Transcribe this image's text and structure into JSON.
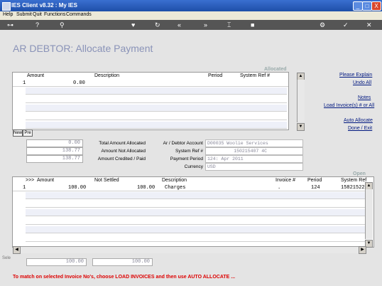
{
  "window": {
    "title": "IES Client v8.32 : My IES",
    "min": "_",
    "max": "□",
    "close": "X"
  },
  "menu": [
    "Help",
    "Submit",
    "Quit",
    "Functions",
    "Commands"
  ],
  "page_title": "AR DEBTOR: Allocate Payment",
  "allocated": {
    "section_label": "Allocated",
    "headers": {
      "amount": "Amount",
      "description": "Description",
      "period": "Period",
      "sysref": "System Ref #"
    },
    "row1": {
      "num": "1",
      "amount": "0.00"
    },
    "tabs": {
      "new": "New",
      "pre": "Pre"
    }
  },
  "links": {
    "explain": "Please Explain",
    "undo": "Undo All",
    "notes": "Notes",
    "load": "Load Invoice(s) # or All",
    "auto": "Auto Allocate",
    "done": "Done / Exit"
  },
  "totals": {
    "allocated": "0.00",
    "not_allocated": "138.77",
    "credited": "138.77",
    "lbl_allocated": "Total Amount Allocated",
    "lbl_not_allocated": "Amount Not Allocated",
    "lbl_credited": "Amount Credited / Paid"
  },
  "account": {
    "lbl_account": "Ar / Debtor Account",
    "account": "D00035 Woolie Services",
    "lbl_sysref": "System Ref #",
    "sysref": "150215407 4C",
    "lbl_period": "Payment Period",
    "period": "124: Apr 2011",
    "lbl_currency": "Currency",
    "currency": "USD"
  },
  "open": {
    "section_label": "Open",
    "headers": {
      "arrow": ">>>",
      "amount": "Amount",
      "not_settled": "Not Settled",
      "description": "Description",
      "invoice": "Invoice #",
      "period": "Period",
      "sysref": "System Ref"
    },
    "row1": {
      "num": "1",
      "amount": "100.00",
      "not_settled": "100.00",
      "description": "Charges",
      "invoice": ".",
      "period": "124",
      "sysref": "15821522"
    }
  },
  "bottom_totals": {
    "a": "100.00",
    "b": "100.00"
  },
  "side_label": "Sele",
  "message": "To match on selected Invoice No's, choose LOAD INVOICES and then use AUTO ALLOCATE ..."
}
